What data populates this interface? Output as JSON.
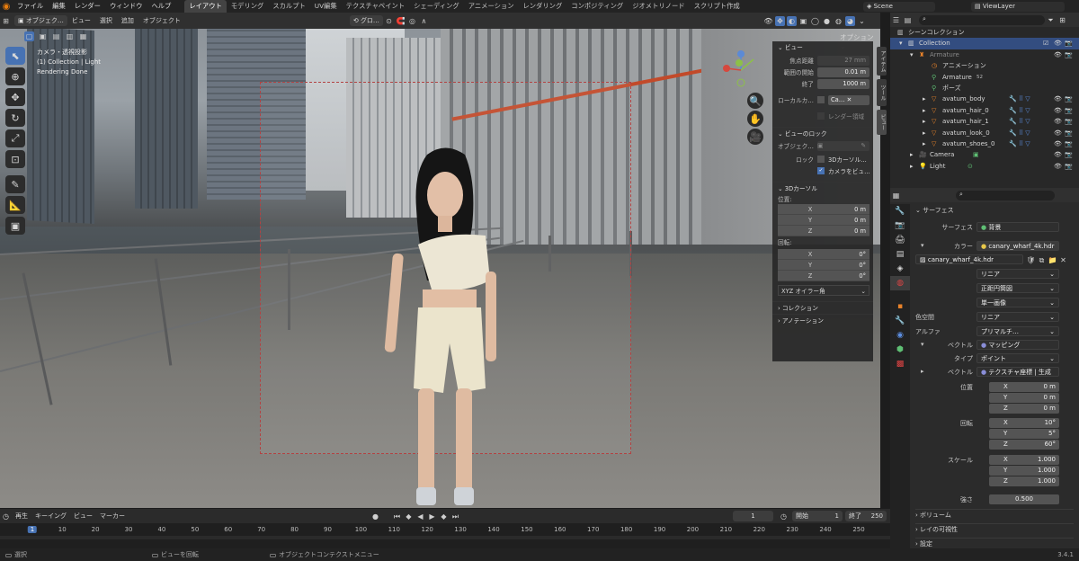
{
  "menu": [
    "ファイル",
    "編集",
    "レンダー",
    "ウィンドウ",
    "ヘルプ"
  ],
  "workspaces": [
    "レイアウト",
    "モデリング",
    "スカルプト",
    "UV編集",
    "テクスチャペイント",
    "シェーディング",
    "アニメーション",
    "レンダリング",
    "コンポジティング",
    "ジオメトリノード",
    "スクリプト作成"
  ],
  "scene": "Scene",
  "view_layer": "ViewLayer",
  "viewport_header": {
    "mode": "オブジェク…",
    "view": "ビュー",
    "select": "選択",
    "add": "追加",
    "object": "オブジェクト",
    "orientation": "グロ…",
    "options": "オプション"
  },
  "viewport_info": {
    "line1": "カメラ・透視投影",
    "line2": "(1) Collection | Light",
    "line3": "Rendering Done"
  },
  "npanel": {
    "view_title": "ビュー",
    "focal_label": "焦点距離",
    "focal_value": "27 mm",
    "clip_start_label": "範囲の開始",
    "clip_start_value": "0.01 m",
    "clip_end_label": "終了",
    "clip_end_value": "1000 m",
    "local_camera_label": "ローカルカ…",
    "local_camera_value": "Ca…",
    "render_region": "レンダー領域",
    "view_lock_title": "ビューのロック",
    "lock_object_label": "オブジェク…",
    "lock_label": "ロック",
    "lock_3d_cursor": "3Dカーソル…",
    "lock_camera": "カメラをビュ…",
    "cursor_title": "3Dカーソル",
    "location_label": "位置:",
    "loc": [
      {
        "axis": "X",
        "value": "0 m"
      },
      {
        "axis": "Y",
        "value": "0 m"
      },
      {
        "axis": "Z",
        "value": "0 m"
      }
    ],
    "rotation_label": "回転:",
    "rot": [
      {
        "axis": "X",
        "value": "0°"
      },
      {
        "axis": "Y",
        "value": "0°"
      },
      {
        "axis": "Z",
        "value": "0°"
      }
    ],
    "rot_mode": "XYZ オイラー角",
    "collection_title": "コレクション",
    "annotation_title": "アノテーション",
    "tabs": [
      "アイテム",
      "ツール",
      "ビュー"
    ]
  },
  "timeline": {
    "playback": "再生",
    "keying": "キーイング",
    "view": "ビュー",
    "marker": "マーカー",
    "current_frame": "1",
    "start_label": "開始",
    "start": "1",
    "end_label": "終了",
    "end": "250",
    "ticks": [
      "1",
      "10",
      "20",
      "30",
      "40",
      "50",
      "60",
      "70",
      "80",
      "90",
      "100",
      "110",
      "120",
      "130",
      "140",
      "150",
      "160",
      "170",
      "180",
      "190",
      "200",
      "210",
      "220",
      "230",
      "240",
      "250"
    ]
  },
  "statusbar": {
    "select": "選択",
    "rotate_view": "ビューを回転",
    "context_menu": "オブジェクトコンテクストメニュー",
    "version": "3.4.1"
  },
  "outliner": {
    "root": "シーンコレクション",
    "items": [
      {
        "name": "Collection",
        "indent": 0
      },
      {
        "name": "Armature",
        "indent": 1
      },
      {
        "name": "アニメーション",
        "indent": 2
      },
      {
        "name": "Armature",
        "indent": 2
      },
      {
        "name": "ポーズ",
        "indent": 2
      },
      {
        "name": "avatum_body",
        "indent": 2
      },
      {
        "name": "avatum_hair_0",
        "indent": 2
      },
      {
        "name": "avatum_hair_1",
        "indent": 2
      },
      {
        "name": "avatum_look_0",
        "indent": 2
      },
      {
        "name": "avatum_shoes_0",
        "indent": 2
      },
      {
        "name": "Camera",
        "indent": 1
      },
      {
        "name": "Light",
        "indent": 1
      }
    ],
    "armature_badge": "52"
  },
  "properties": {
    "section": "サーフェス",
    "surface_label": "サーフェス",
    "surface_value": "背景",
    "color_label": "カラー",
    "color_value": "canary_wharf_4k.hdr",
    "image_name": "canary_wharf_4k.hdr",
    "interp": "リニア",
    "projection": "正距円筒図",
    "source": "単一画像",
    "colorspace_label": "色空間",
    "colorspace": "リニア",
    "alpha_label": "アルファ",
    "alpha": "プリマルチ…",
    "vector_label": "ベクトル",
    "vector_value": "マッピング",
    "type_label": "タイプ",
    "type_value": "ポイント",
    "vector2_label": "ベクトル",
    "vector2_value": "テクスチャ座標 | 生成",
    "location_label": "位置",
    "location": [
      {
        "axis": "X",
        "value": "0 m"
      },
      {
        "axis": "Y",
        "value": "0 m"
      },
      {
        "axis": "Z",
        "value": "0 m"
      }
    ],
    "rotation_label": "回転",
    "rotation": [
      {
        "axis": "X",
        "value": "10°"
      },
      {
        "axis": "Y",
        "value": "5°"
      },
      {
        "axis": "Z",
        "value": "60°"
      }
    ],
    "scale_label": "スケール",
    "scale": [
      {
        "axis": "X",
        "value": "1.000"
      },
      {
        "axis": "Y",
        "value": "1.000"
      },
      {
        "axis": "Z",
        "value": "1.000"
      }
    ],
    "strength_label": "強さ",
    "strength": "0.500",
    "volume": "ボリューム",
    "ray_visibility": "レイの可視性",
    "settings": "設定"
  }
}
